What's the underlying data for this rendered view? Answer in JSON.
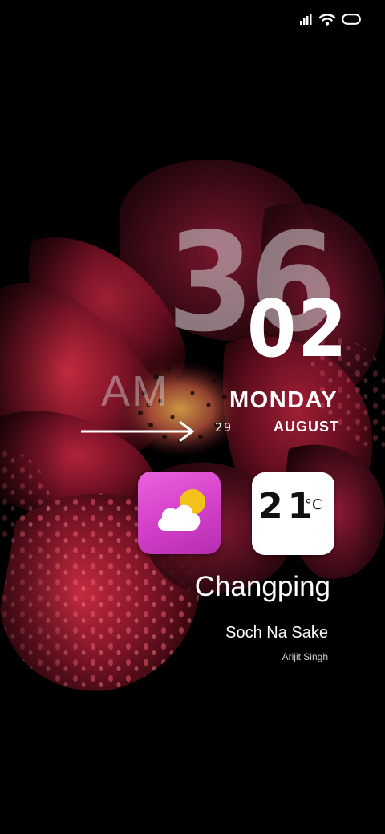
{
  "status_bar": {
    "signal_icon": "signal-bars-icon",
    "wifi_icon": "wifi-icon",
    "battery_icon": "battery-icon"
  },
  "clock": {
    "hour": "36",
    "minutes": "02",
    "period": "AM",
    "weekday": "MONDAY",
    "day": "29",
    "month": "AUGUST"
  },
  "weather": {
    "icon": "partly-cloudy-icon",
    "temperature": "21",
    "unit": "°C",
    "city": "Changping"
  },
  "music": {
    "title": "Soch Na Sake",
    "artist": "Arijit Singh"
  },
  "colors": {
    "weather_tile": "#d94ad0",
    "temp_tile": "#ffffff",
    "sun": "#f2c21b",
    "background": "#000000"
  }
}
